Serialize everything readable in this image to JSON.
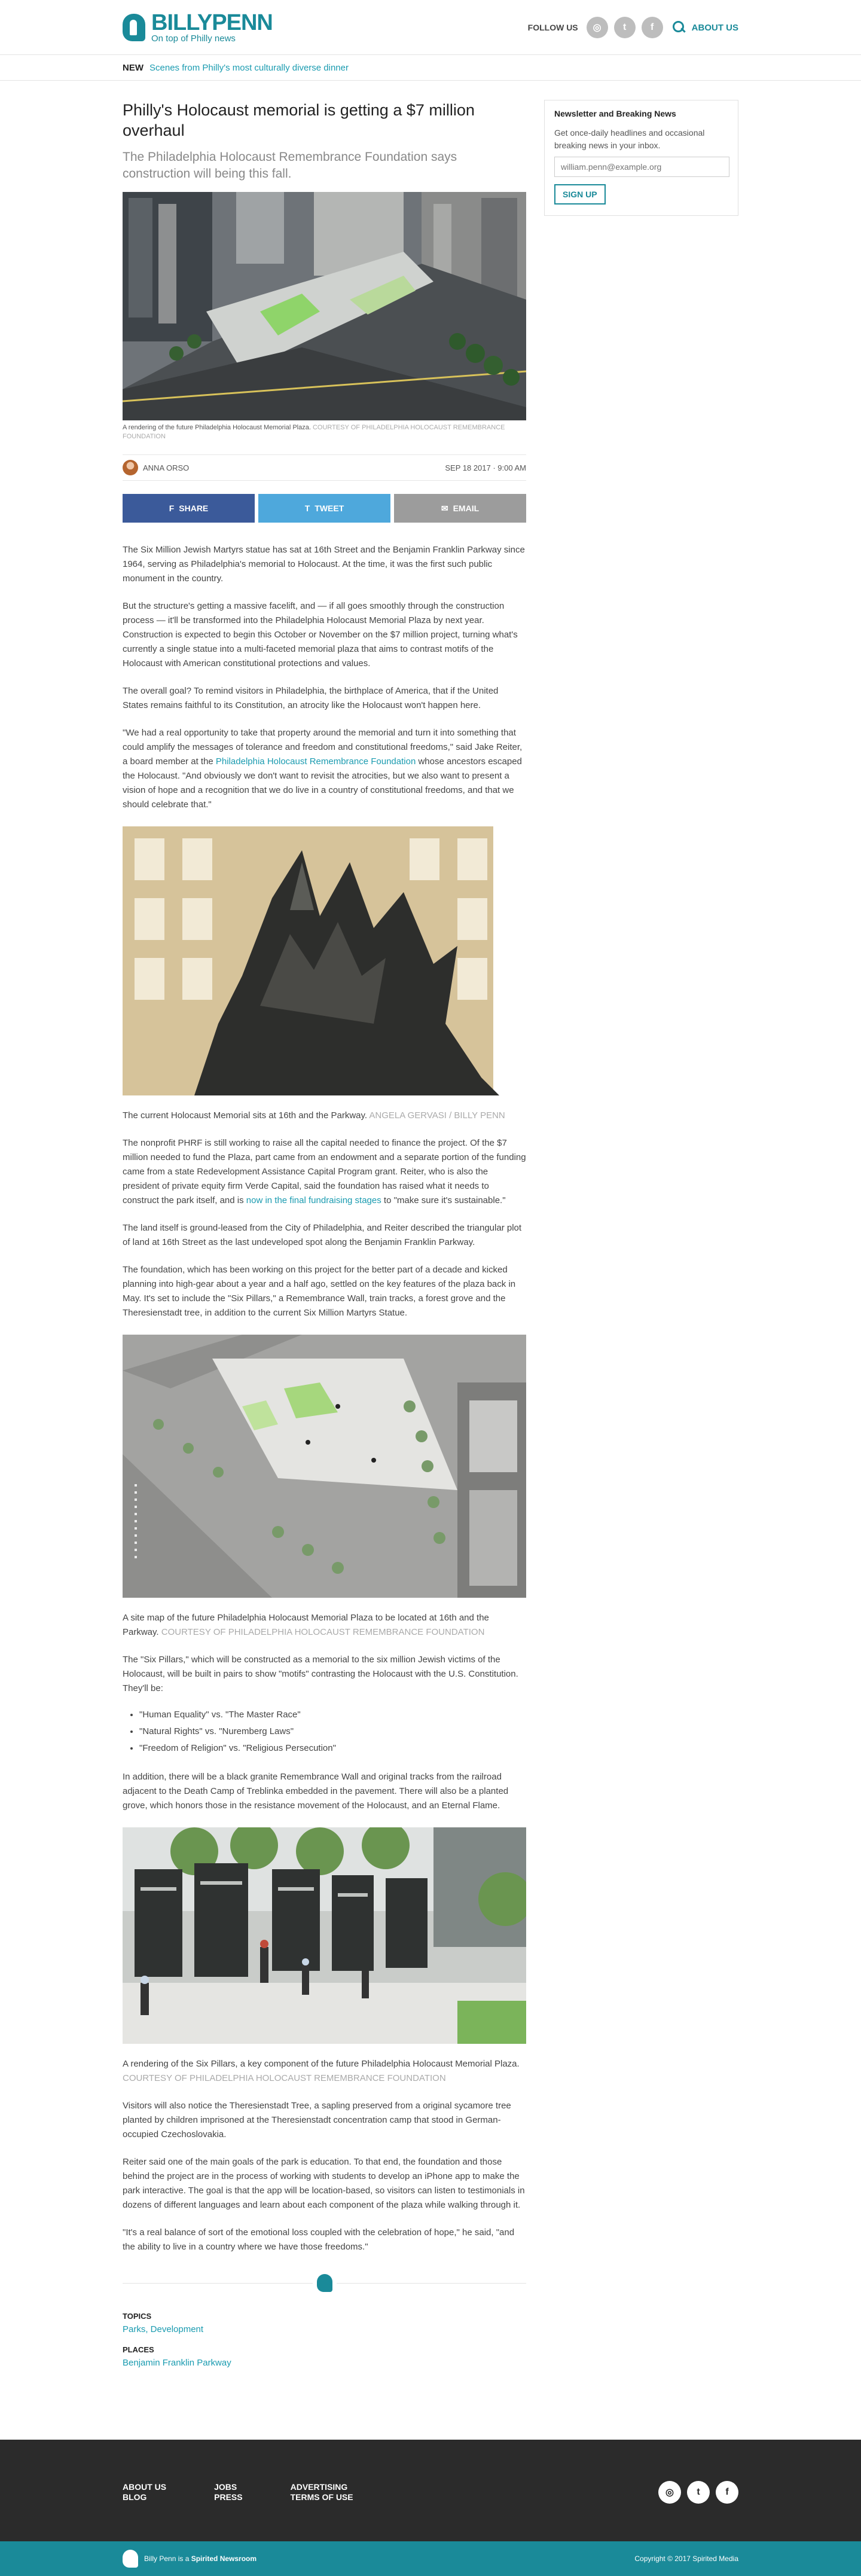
{
  "header": {
    "brand": "BILLYPENN",
    "tagline": "On top of Philly news",
    "follow_label": "FOLLOW US",
    "social": [
      "instagram-icon",
      "twitter-icon",
      "facebook-icon"
    ],
    "about_label": "ABOUT US"
  },
  "newsbar": {
    "label": "NEW",
    "link": "Scenes from Philly's most culturally diverse dinner"
  },
  "article": {
    "title": "Philly's Holocaust memorial is getting a $7 million overhaul",
    "subtitle": "The Philadelphia Holocaust Remembrance Foundation says construction will being this fall.",
    "hero_caption": "A rendering of the future Philadelphia Holocaust Memorial Plaza.",
    "hero_credit": "COURTESY OF PHILADELPHIA HOLOCAUST REMEMBRANCE FOUNDATION",
    "author": "ANNA ORSO",
    "date": "SEP 18 2017 · 9:00 AM",
    "share": {
      "facebook": "SHARE",
      "twitter": "TWEET",
      "email": "EMAIL"
    },
    "p1": "The Six Million Jewish Martyrs statue has sat at 16th Street and the Benjamin Franklin Parkway since 1964, serving as Philadelphia's memorial to Holocaust. At the time, it was the first such public monument in the country.",
    "p2": "But the structure's getting a massive facelift, and — if all goes smoothly through the construction process — it'll be transformed into the Philadelphia Holocaust Memorial Plaza by next year. Construction is expected to begin this October or November on the $7 million project, turning what's currently a single statue into a multi-faceted memorial plaza that aims to contrast motifs of the Holocaust with American constitutional protections and values.",
    "p3": "The overall goal? To remind visitors in Philadelphia, the birthplace of America, that if the United States remains faithful to its Constitution, an atrocity like the Holocaust won't happen here.",
    "p4a": "\"We had a real opportunity to take that property around the memorial and turn it into something that could amplify the messages of tolerance and freedom and constitutional freedoms,\" said Jake Reiter, a board member at the ",
    "p4link": "Philadelphia Holocaust Remembrance Foundation",
    "p4b": " whose ancestors escaped the Holocaust. \"And obviously we don't want to revisit the atrocities, but we also want to present a vision of hope and a recognition that we do live in a country of constitutional freedoms, and that we should celebrate that.\"",
    "statue_caption": "The current Holocaust Memorial sits at 16th and the Parkway.",
    "statue_credit": "ANGELA GERVASI / BILLY PENN",
    "p5a": "The nonprofit PHRF is still working to raise all the capital needed to finance the project. Of the $7 million needed to fund the Plaza, part came from an endowment and a separate portion of the funding came from a state Redevelopment Assistance Capital Program grant. Reiter, who is also the president of private equity firm Verde Capital, said the foundation has raised what it needs to construct the park itself, and is ",
    "p5link": "now in the final fundraising stages",
    "p5b": " to \"make sure it's sustainable.\"",
    "p6": "The land itself is ground-leased from the City of Philadelphia, and Reiter described the triangular plot of land at 16th Street as the last undeveloped spot along the Benjamin Franklin Parkway.",
    "p7": "The foundation, which has been working on this project for the better part of a decade and kicked planning into high-gear about a year and a half ago, settled on the key features of the plaza back in May. It's set to include the \"Six Pillars,\" a Remembrance Wall, train tracks, a forest grove and the Theresienstadt tree, in addition to the current Six Million Martyrs Statue.",
    "map_caption": "A site map of the future Philadelphia Holocaust Memorial Plaza to be located at 16th and the Parkway.",
    "map_credit": "COURTESY OF PHILADELPHIA HOLOCAUST REMEMBRANCE FOUNDATION",
    "p8": "The \"Six Pillars,\" which will be constructed as a memorial to the six million Jewish victims of the Holocaust, will be built in pairs to show \"motifs\" contrasting the Holocaust with the U.S. Constitution. They'll be:",
    "bullets": [
      "\"Human Equality\" vs. \"The Master Race\"",
      "\"Natural Rights\" vs. \"Nuremberg Laws\"",
      "\"Freedom of Religion\" vs. \"Religious Persecution\""
    ],
    "p9": "In addition, there will be a black granite Remembrance Wall and original tracks from the railroad adjacent to the Death Camp of Treblinka embedded in the pavement. There will also be a planted grove, which honors those in the resistance movement of the Holocaust, and an Eternal Flame.",
    "pillars_caption": "A rendering of the Six Pillars, a key component of the future Philadelphia Holocaust Memorial Plaza.",
    "pillars_credit": "COURTESY OF PHILADELPHIA HOLOCAUST REMEMBRANCE FOUNDATION",
    "p10": "Visitors will also notice the Theresienstadt Tree, a sapling preserved from a original sycamore tree planted by children imprisoned at the Theresienstadt concentration camp that stood in German-occupied Czechoslovakia.",
    "p11": "Reiter said one of the main goals of the park is education. To that end, the foundation and those behind the project are in the process of working with students to develop an iPhone app to make the park interactive. The goal is that the app will be location-based, so visitors can listen to testimonials in dozens of different languages and learn about each component of the plaza while walking through it.",
    "p12": "\"It's a real balance of sort of the emotional loss coupled with the celebration of hope,\" he said, \"and the ability to live in a country where we have those freedoms.\"",
    "topics_label": "TOPICS",
    "topics": "Parks, Development",
    "places_label": "PLACES",
    "places": "Benjamin Franklin Parkway"
  },
  "sidebar": {
    "title": "Newsletter and Breaking News",
    "desc": "Get once-daily headlines and occasional breaking news in your inbox.",
    "placeholder": "william.penn@example.org",
    "button": "SIGN UP"
  },
  "footer": {
    "col1": [
      "ABOUT US",
      "BLOG"
    ],
    "col2": [
      "JOBS",
      "PRESS"
    ],
    "col3": [
      "ADVERTISING",
      "TERMS OF USE"
    ],
    "social": [
      "instagram-icon",
      "twitter-icon",
      "facebook-icon"
    ],
    "network_pre": "Billy Penn is a ",
    "network_name": "Spirited Newsroom",
    "copyright": "Copyright © 2017 Spirited Media"
  },
  "colors": {
    "brand": "#1a8a99",
    "link": "#1a9bb0",
    "facebook": "#3b5a9a",
    "twitter": "#4ea8dc",
    "footer": "#2b2b2b"
  }
}
